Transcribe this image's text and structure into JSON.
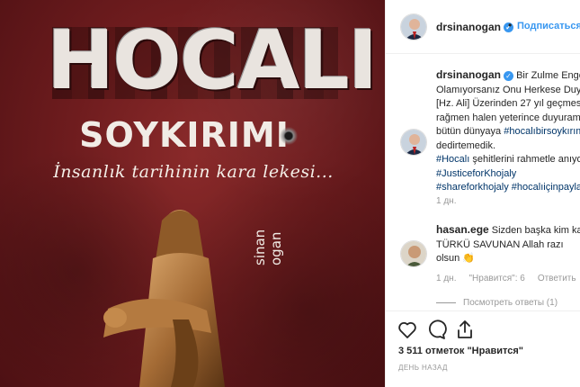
{
  "post_image": {
    "title": "HOCALI",
    "subtitle": "SOYKIRIMI",
    "tagline": "İnsanlık tarihinin kara lekesi...",
    "author_mark": "sinan ogan"
  },
  "header": {
    "username": "drsinanogan",
    "separator": "•",
    "follow_label": "Подписаться"
  },
  "caption": {
    "username": "drsinanogan",
    "lines": [
      "Bir Zulme Engel",
      "Olamıyorsanız Onu Herkese Duyu",
      "[Hz. Ali] Üzerinden 27 yıl geçmes",
      "rağmen halen yeterince duyuram",
      "bütün dünyaya",
      "#hocalıbirsoykırım",
      "dedirtemedik.",
      "#Hocalı",
      "şehitlerini rahmetle anıyo",
      "#JusticeforKhojaly",
      "#shareforkhojaly",
      "#hocalıiçinpaylaş"
    ],
    "time": "1 дн."
  },
  "comment": {
    "username": "hasan.ege",
    "text_line1": "Sizden başka kim kald",
    "text_line2": "TÜRKÜ SAVUNAN Allah razı",
    "text_line3": "olsun 👏",
    "time": "1 дн.",
    "likes": "\"Нравится\": 6",
    "reply": "Ответить",
    "view_replies": "Посмотреть ответы (1)"
  },
  "actions": {
    "likes_text": "3 511 отметок \"Нравится\"",
    "posted": "ДЕНЬ НАЗАД"
  },
  "colors": {
    "accent": "#3897f0",
    "hashtag": "#003569",
    "muted": "#999999",
    "image_bg": "#6e1c1e"
  },
  "icons": [
    "heart-icon",
    "comment-icon",
    "share-icon",
    "verified-icon"
  ]
}
